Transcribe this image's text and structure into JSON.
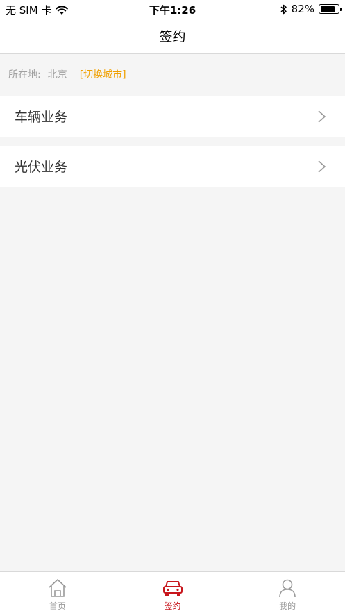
{
  "status_bar": {
    "carrier": "无 SIM 卡",
    "time": "下午1:26",
    "battery_text": "82%",
    "battery_level": 0.82
  },
  "nav": {
    "title": "签约"
  },
  "location": {
    "label": "所在地:",
    "city": "北京",
    "switch_label": "[切换城市]"
  },
  "list": [
    {
      "label": "车辆业务"
    },
    {
      "label": "光伏业务"
    }
  ],
  "tabs": [
    {
      "label": "首页",
      "icon": "home-icon",
      "active": false
    },
    {
      "label": "签约",
      "icon": "car-icon",
      "active": true
    },
    {
      "label": "我的",
      "icon": "user-icon",
      "active": false
    }
  ],
  "colors": {
    "accent_active": "#c8161d",
    "inactive": "#999999",
    "switch_city": "#f0a000"
  }
}
